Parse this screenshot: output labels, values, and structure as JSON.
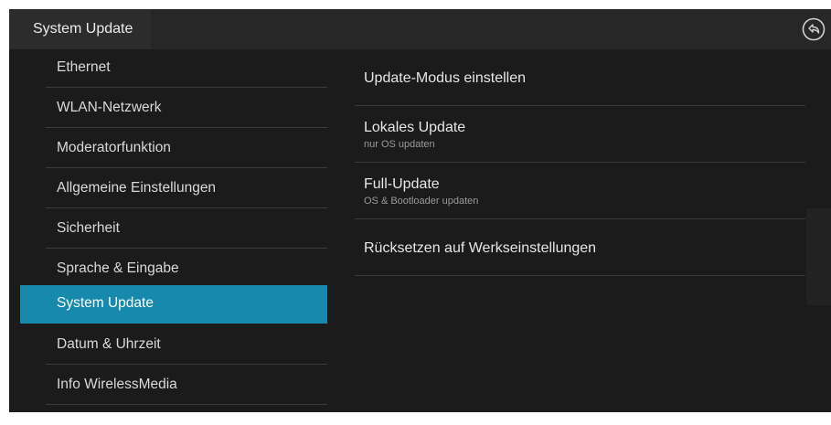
{
  "header": {
    "title": "System Update",
    "back_icon": "back-arrow-icon"
  },
  "sidebar": {
    "items": [
      {
        "label": "Ethernet",
        "active": false
      },
      {
        "label": "WLAN-Netzwerk",
        "active": false
      },
      {
        "label": "Moderatorfunktion",
        "active": false
      },
      {
        "label": "Allgemeine Einstellungen",
        "active": false
      },
      {
        "label": "Sicherheit",
        "active": false
      },
      {
        "label": "Sprache & Eingabe",
        "active": false
      },
      {
        "label": "System Update",
        "active": true
      },
      {
        "label": "Datum & Uhrzeit",
        "active": false
      },
      {
        "label": "Info WirelessMedia",
        "active": false
      }
    ]
  },
  "main": {
    "options": [
      {
        "title": "Update-Modus einstellen",
        "subtitle": ""
      },
      {
        "title": "Lokales Update",
        "subtitle": "nur OS updaten"
      },
      {
        "title": "Full-Update",
        "subtitle": "OS & Bootloader updaten"
      },
      {
        "title": "Rücksetzen auf Werkseinstellungen",
        "subtitle": ""
      }
    ]
  },
  "colors": {
    "accent": "#1689ad",
    "background": "#1b1b1b",
    "topbar": "#272727"
  }
}
